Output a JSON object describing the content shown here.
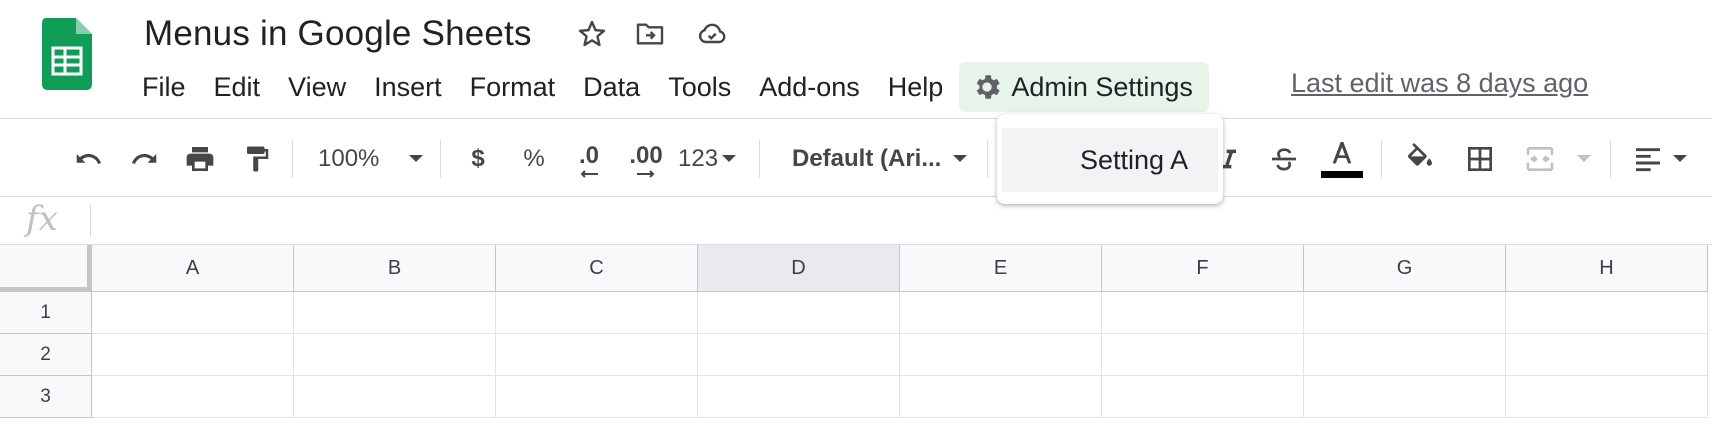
{
  "header": {
    "title": "Menus in Google Sheets",
    "last_edit": "Last edit was 8 days ago"
  },
  "menubar": {
    "items": [
      "File",
      "Edit",
      "View",
      "Insert",
      "Format",
      "Data",
      "Tools",
      "Add-ons",
      "Help"
    ],
    "admin_label": "Admin Settings"
  },
  "dropdown": {
    "items": [
      "Setting A"
    ]
  },
  "toolbar": {
    "zoom": "100%",
    "currency": "$",
    "percent": "%",
    "decrease_decimal": ".0",
    "increase_decimal": ".00",
    "more_formats": "123",
    "font": "Default (Ari..."
  },
  "formula_bar": {
    "fx": "fx"
  },
  "grid": {
    "columns": [
      "A",
      "B",
      "C",
      "D",
      "E",
      "F",
      "G",
      "H"
    ],
    "rows": [
      "1",
      "2",
      "3"
    ],
    "selected_column": "D"
  },
  "colors": {
    "brand_green": "#0f9d58",
    "admin_highlight": "#e6f4ea",
    "text_color_bar": "#000000"
  }
}
